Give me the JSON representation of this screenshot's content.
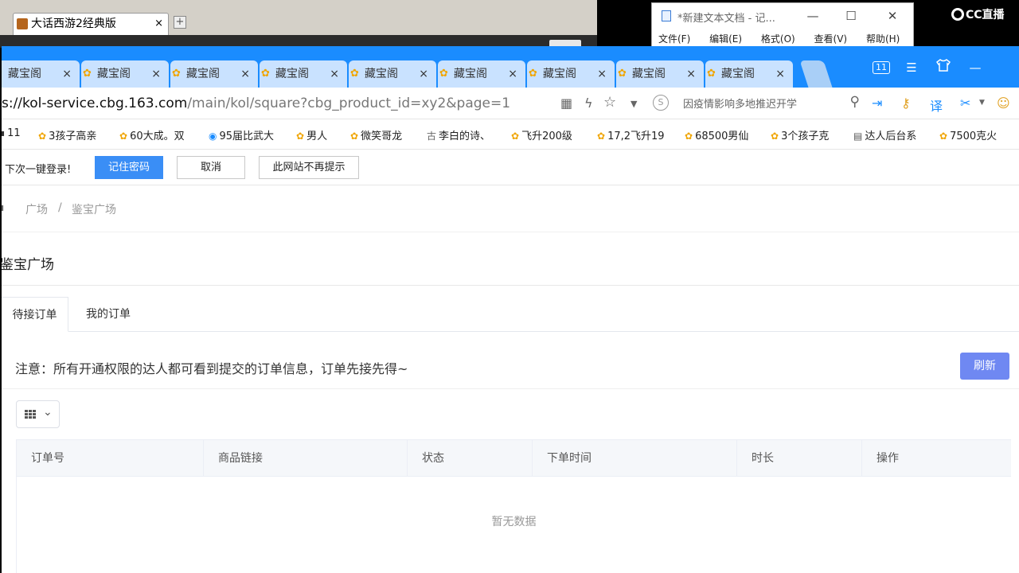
{
  "bg_window": {
    "tab_label": "大话西游2经典版",
    "close": "×",
    "new_tab": "+"
  },
  "notepad": {
    "title": "*新建文本文档 - 记...",
    "minimize": "—",
    "maximize": "☐",
    "close": "✕",
    "menu": [
      "文件(F)",
      "编辑(E)",
      "格式(O)",
      "查看(V)",
      "帮助(H)"
    ]
  },
  "overlay": {
    "logo_text": "CC直播"
  },
  "browser": {
    "tabs": [
      {
        "label": "藏宝阁"
      },
      {
        "label": "藏宝阁"
      },
      {
        "label": "藏宝阁"
      },
      {
        "label": "藏宝阁"
      },
      {
        "label": "藏宝阁"
      },
      {
        "label": "藏宝阁"
      },
      {
        "label": "藏宝阁"
      },
      {
        "label": "藏宝阁"
      },
      {
        "label": "藏宝阁"
      }
    ],
    "tab_close": "×",
    "tab_count": "11",
    "menu_icon": "☰",
    "minimize": "—",
    "address": {
      "host": "s://kol-service.cbg.163.com",
      "path": "/main/kol/square?cbg_product_id=xy2&page=1"
    },
    "search_placeholder": "因疫情影响多地推迟开学",
    "bookmarks": [
      "11",
      "3孩子高亲",
      "60大成。双",
      "95届比武大",
      "男人",
      "微笑哥龙",
      "李白的诗、",
      "飞升200级",
      "17,2飞升19",
      "68500男仙",
      "3个孩子克",
      "达人后台系",
      "7500克火"
    ],
    "password_bar": {
      "message": "下次一键登录!",
      "save": "记住密码",
      "cancel": "取消",
      "never": "此网站不再提示"
    }
  },
  "page": {
    "breadcrumb": {
      "root": "广场",
      "separator": "/",
      "current": "鉴宝广场"
    },
    "title": "鉴宝广场",
    "tabs": [
      {
        "label": "待接订单",
        "active": true
      },
      {
        "label": "我的订单",
        "active": false
      }
    ],
    "notice": "注意：所有开通权限的达人都可看到提交的订单信息，订单先接先得~",
    "refresh_label": "刷新",
    "table": {
      "columns": [
        "订单号",
        "商品链接",
        "状态",
        "下单时间",
        "时长",
        "操作"
      ],
      "empty_text": "暂无数据"
    }
  },
  "colors": {
    "tabstrip": "#1a8cff",
    "primary_button": "#3a8ef6",
    "refresh_button": "#6f88f2"
  }
}
